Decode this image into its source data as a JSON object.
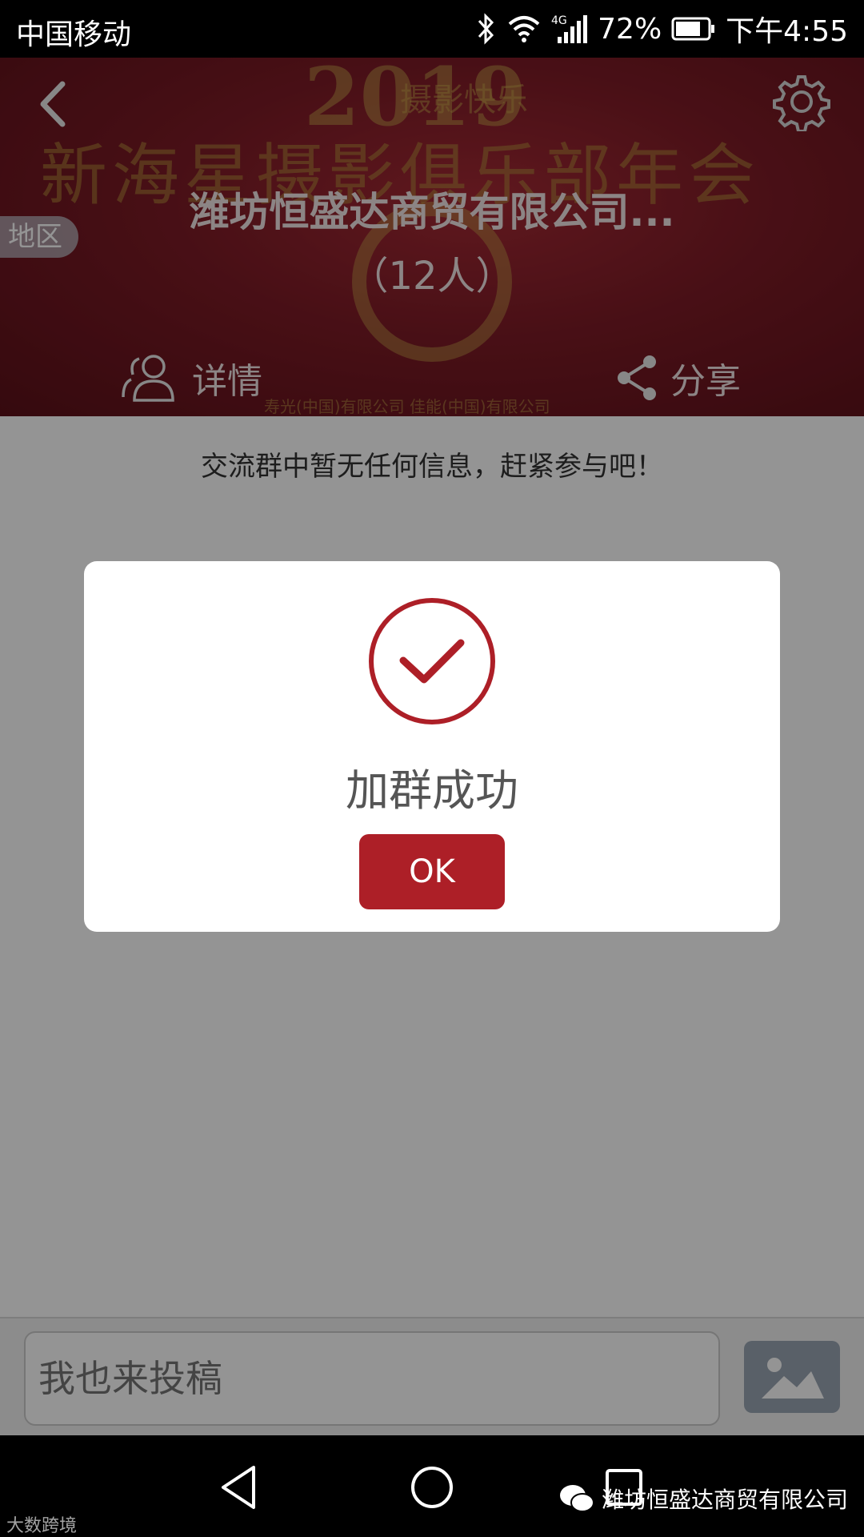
{
  "status_bar": {
    "carrier": "中国移动",
    "network": "4G",
    "battery": "72%",
    "time": "下午4:55"
  },
  "header": {
    "banner_text": {
      "year": "2019",
      "subtitle": "摄影快乐",
      "title": "新海星摄影俱乐部年会",
      "small_text": "寿光(中国)有限公司    佳能(中国)有限公司"
    },
    "region_tag": "地区",
    "group_title": "潍坊恒盛达商贸有限公司...",
    "member_count": "（12人）",
    "detail_label": "详情",
    "share_label": "分享"
  },
  "content": {
    "empty_message": "交流群中暂无任何信息，赶紧参与吧！"
  },
  "input_bar": {
    "placeholder": "我也来投稿"
  },
  "dialog": {
    "message": "加群成功",
    "ok_label": "OK"
  },
  "watermarks": {
    "left": "大数跨境",
    "right": "潍坊恒盛达商贸有限公司"
  },
  "colors": {
    "accent": "#ad1f27",
    "banner": "#7d1b26"
  },
  "icons": [
    "back-icon",
    "settings-icon",
    "users-icon",
    "share-icon",
    "image-icon",
    "check-circle-icon"
  ]
}
